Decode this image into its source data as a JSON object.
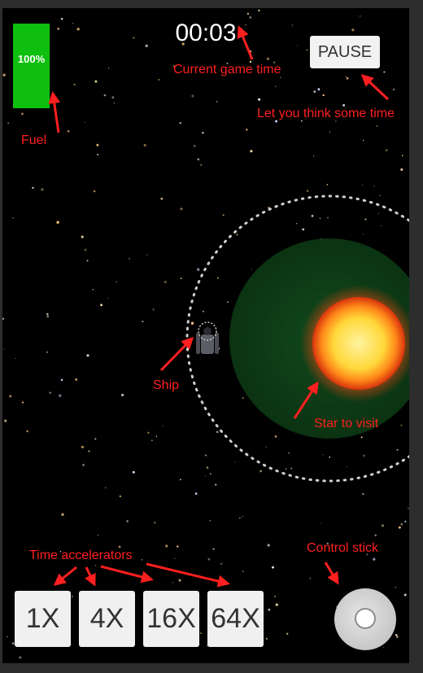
{
  "hud": {
    "fuel_label": "100%",
    "fuel_level": 1.0,
    "timer": "00:03",
    "pause_label": "PAUSE"
  },
  "accelerators": [
    "1X",
    "4X",
    "16X",
    "64X"
  ],
  "annotations": {
    "fuel": "Fuel",
    "time": "Current game time",
    "pause": "Let you think some time",
    "ship": "Ship",
    "star": "Star to visit",
    "accelerators": "Time accelerators",
    "control_stick": "Control stick"
  },
  "colors": {
    "fuel": "#0fbf0f",
    "annotation": "#ff1f1f",
    "star_zone": "#0d3a14",
    "star_core": "#ffe24a",
    "background": "#000000"
  },
  "icons": [
    "ship-icon",
    "star-icon",
    "orbit-ring",
    "control-stick-knob"
  ]
}
